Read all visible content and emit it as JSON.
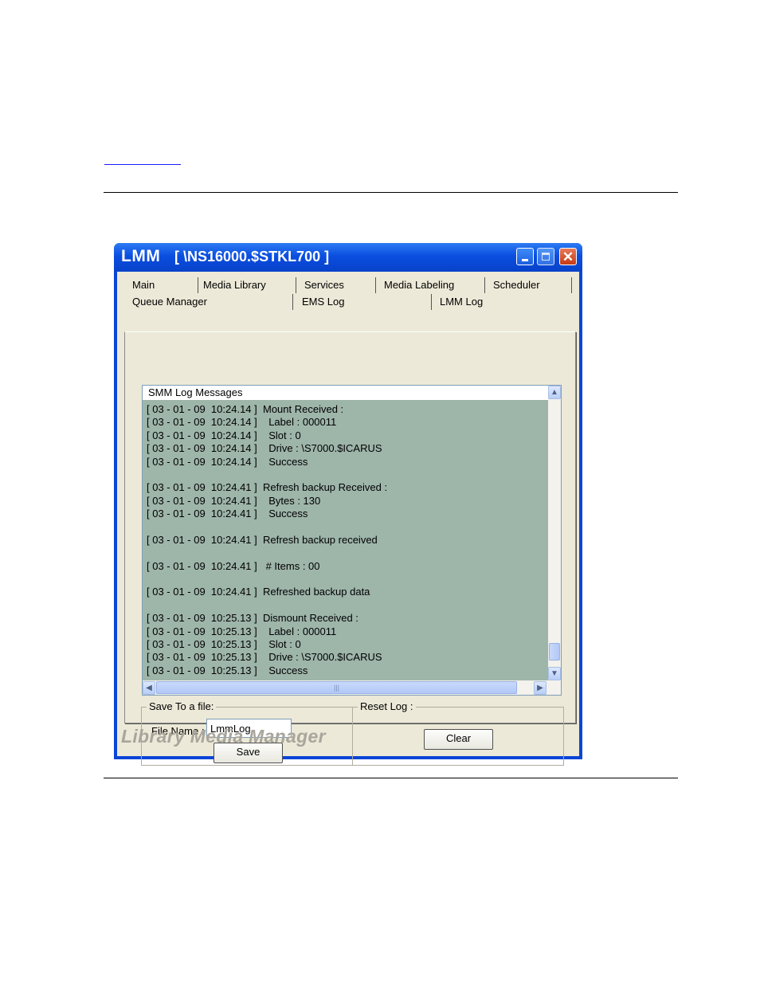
{
  "window": {
    "app_name": "LMM",
    "path": "[ \\NS16000.$STKL700 ]"
  },
  "tabs_row1": [
    "Main",
    "Media Library",
    "Services",
    "Media Labeling",
    "Scheduler"
  ],
  "tabs_row2": [
    "Queue Manager",
    "EMS Log",
    "LMM Log"
  ],
  "active_tab": "LMM Log",
  "log": {
    "header": "SMM Log Messages",
    "lines": [
      "[ 03 - 01 - 09  10:24.14 ]  Mount Received :",
      "[ 03 - 01 - 09  10:24.14 ]    Label : 000011",
      "[ 03 - 01 - 09  10:24.14 ]    Slot : 0",
      "[ 03 - 01 - 09  10:24.14 ]    Drive : \\S7000.$ICARUS",
      "[ 03 - 01 - 09  10:24.14 ]    Success",
      "",
      "[ 03 - 01 - 09  10:24.41 ]  Refresh backup Received :",
      "[ 03 - 01 - 09  10:24.41 ]    Bytes : 130",
      "[ 03 - 01 - 09  10:24.41 ]    Success",
      "",
      "[ 03 - 01 - 09  10:24.41 ]  Refresh backup received",
      "",
      "[ 03 - 01 - 09  10:24.41 ]   # Items : 00",
      "",
      "[ 03 - 01 - 09  10:24.41 ]  Refreshed backup data",
      "",
      "[ 03 - 01 - 09  10:25.13 ]  Dismount Received :",
      "[ 03 - 01 - 09  10:25.13 ]    Label : 000011",
      "[ 03 - 01 - 09  10:25.13 ]    Slot : 0",
      "[ 03 - 01 - 09  10:25.13 ]    Drive : \\S7000.$ICARUS",
      "[ 03 - 01 - 09  10:25.13 ]    Success"
    ]
  },
  "save_group": {
    "label": "Save To a file:",
    "file_name_label": "File Name :",
    "file_name_value": "LmmLog",
    "save_button": "Save"
  },
  "reset_group": {
    "label": "Reset Log :",
    "clear_button": "Clear"
  },
  "brand": "Library Media Manager",
  "colors": {
    "titlebar": "#0a4ee0",
    "log_background": "#9eb5aa",
    "dialog_background": "#ece9d8"
  }
}
